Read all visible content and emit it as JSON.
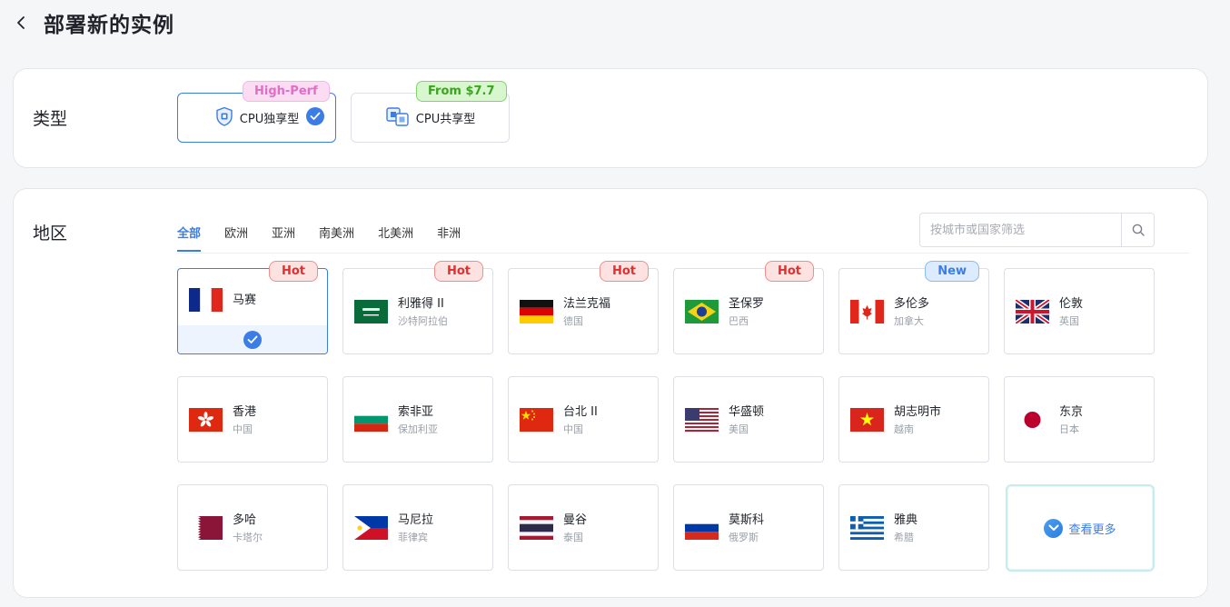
{
  "header": {
    "title": "部署新的实例"
  },
  "type_section": {
    "label": "类型",
    "options": [
      {
        "label": "CPU独享型",
        "badge": "High-Perf",
        "selected": true
      },
      {
        "label": "CPU共享型",
        "badge": "From $7.7",
        "selected": false
      }
    ]
  },
  "region_section": {
    "label": "地区",
    "tabs": [
      "全部",
      "欧洲",
      "亚洲",
      "南美洲",
      "北美洲",
      "非洲"
    ],
    "active_tab": "全部",
    "search": {
      "placeholder": "按城市或国家筛选",
      "value": ""
    },
    "regions": [
      {
        "city": "马赛",
        "country": "",
        "badge": "Hot",
        "flag": "france",
        "selected": true
      },
      {
        "city": "利雅得 II",
        "country": "沙特阿拉伯",
        "badge": "Hot",
        "flag": "saudi"
      },
      {
        "city": "法兰克福",
        "country": "德国",
        "badge": "Hot",
        "flag": "germany"
      },
      {
        "city": "圣保罗",
        "country": "巴西",
        "badge": "Hot",
        "flag": "brazil"
      },
      {
        "city": "多伦多",
        "country": "加拿大",
        "badge": "New",
        "flag": "canada"
      },
      {
        "city": "伦敦",
        "country": "英国",
        "badge": "",
        "flag": "uk"
      },
      {
        "city": "香港",
        "country": "中国",
        "badge": "",
        "flag": "hongkong"
      },
      {
        "city": "索非亚",
        "country": "保加利亚",
        "badge": "",
        "flag": "bulgaria"
      },
      {
        "city": "台北 II",
        "country": "中国",
        "badge": "",
        "flag": "china"
      },
      {
        "city": "华盛顿",
        "country": "美国",
        "badge": "",
        "flag": "usa"
      },
      {
        "city": "胡志明市",
        "country": "越南",
        "badge": "",
        "flag": "vietnam"
      },
      {
        "city": "东京",
        "country": "日本",
        "badge": "",
        "flag": "japan"
      },
      {
        "city": "多哈",
        "country": "卡塔尔",
        "badge": "",
        "flag": "qatar"
      },
      {
        "city": "马尼拉",
        "country": "菲律宾",
        "badge": "",
        "flag": "philippines"
      },
      {
        "city": "曼谷",
        "country": "泰国",
        "badge": "",
        "flag": "thailand"
      },
      {
        "city": "莫斯科",
        "country": "俄罗斯",
        "badge": "",
        "flag": "russia"
      },
      {
        "city": "雅典",
        "country": "希腊",
        "badge": "",
        "flag": "greece"
      }
    ],
    "more_label": "查看更多"
  },
  "colors": {
    "accent": "#3b7de5",
    "hot": "#e03030",
    "new": "#3b7de5"
  }
}
